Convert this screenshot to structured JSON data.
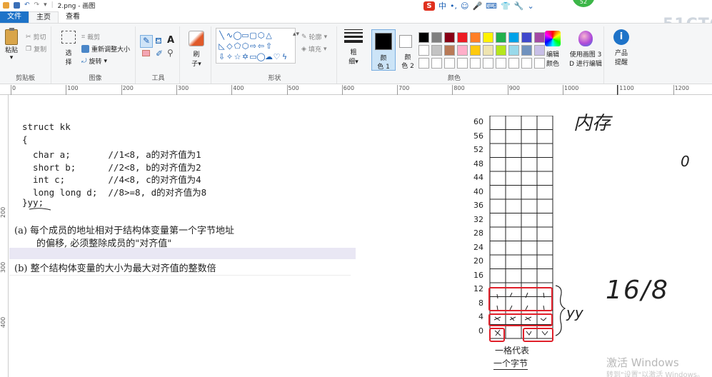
{
  "titlebar": {
    "filename": "2.png - 画图"
  },
  "ime": {
    "brand": "S",
    "lang": "中",
    "glyphs": [
      "•,",
      "☺",
      "🎤",
      "⌨",
      "👕",
      "🔧",
      "⌄"
    ]
  },
  "badge": "52",
  "watermark_top": "51CTO.",
  "tabs": {
    "file": "文件",
    "home": "主页",
    "view": "查看"
  },
  "ribbon": {
    "clipboard": {
      "paste": "粘贴",
      "cut": "剪切",
      "copy": "复制",
      "label": "剪贴板"
    },
    "image": {
      "select": "选",
      "select2": "择",
      "crop": "裁剪",
      "resize": "重新调整大小",
      "rotate": "旋转",
      "label": "图像"
    },
    "tools": {
      "label": "工具"
    },
    "brushes": {
      "label1": "刷",
      "label2": "子"
    },
    "shapes": {
      "outline": "轮廓",
      "fill": "填充",
      "label": "形状"
    },
    "size": {
      "label1": "粗",
      "label2": "细"
    },
    "colors": {
      "color1": "颜",
      "color1b": "色 1",
      "color2": "颜",
      "color2b": "色 2",
      "edit": "编辑",
      "edit2": "颜色",
      "label": "颜色",
      "palette": [
        "#000000",
        "#7f7f7f",
        "#880015",
        "#ed1c24",
        "#ff7f27",
        "#fff200",
        "#22b14c",
        "#00a2e8",
        "#3f48cc",
        "#a349a4",
        "#ffffff",
        "#c3c3c3",
        "#b97a57",
        "#ffaec9",
        "#ffc90e",
        "#efe4b0",
        "#b5e61d",
        "#99d9ea",
        "#7092be",
        "#c8bfe7",
        "#ffffff",
        "#ffffff",
        "#ffffff",
        "#ffffff",
        "#ffffff",
        "#ffffff",
        "#ffffff",
        "#ffffff",
        "#ffffff",
        "#ffffff"
      ]
    },
    "paint3d": {
      "line1": "使用画图 3",
      "line2": "D 进行编辑"
    },
    "product": {
      "line1": "产品",
      "line2": "提醒"
    }
  },
  "ruler": {
    "ticks": [
      "0",
      "100",
      "200",
      "300",
      "400",
      "500",
      "600",
      "700",
      "800",
      "900",
      "1000",
      "1100",
      "1200"
    ],
    "vticks": [
      "200",
      "300",
      "400"
    ]
  },
  "canvas": {
    "code_lines": [
      "struct kk",
      "{",
      "  char a;       //1<8, a的对齐值为1",
      "  short b;      //2<8, b的对齐值为2",
      "  int c;        //4<8, c的对齐值为4",
      "  long long d;  //8>=8, d的对齐值为8",
      "}yy;"
    ],
    "para_a1": "(a) 每个成员的地址相对于结构体变量第一个字节地址",
    "para_a2": "的偏移, 必须整除成员的\"对齐值\"",
    "para_b": "(b) 整个结构体变量的大小为最大对齐值的整数倍",
    "grid_labels": [
      "60",
      "56",
      "52",
      "48",
      "44",
      "40",
      "36",
      "32",
      "28",
      "24",
      "20",
      "16",
      "12",
      "8",
      "4",
      "0"
    ],
    "handwriting": {
      "top": "内存",
      "zero": "0",
      "yy": "yy",
      "calc": "16/8",
      "legend1": "一格代表",
      "legend2": "一个字节"
    }
  },
  "windows_watermark": {
    "line1": "激活 Windows",
    "line2": "转到\"设置\"以激活 Windows。"
  }
}
